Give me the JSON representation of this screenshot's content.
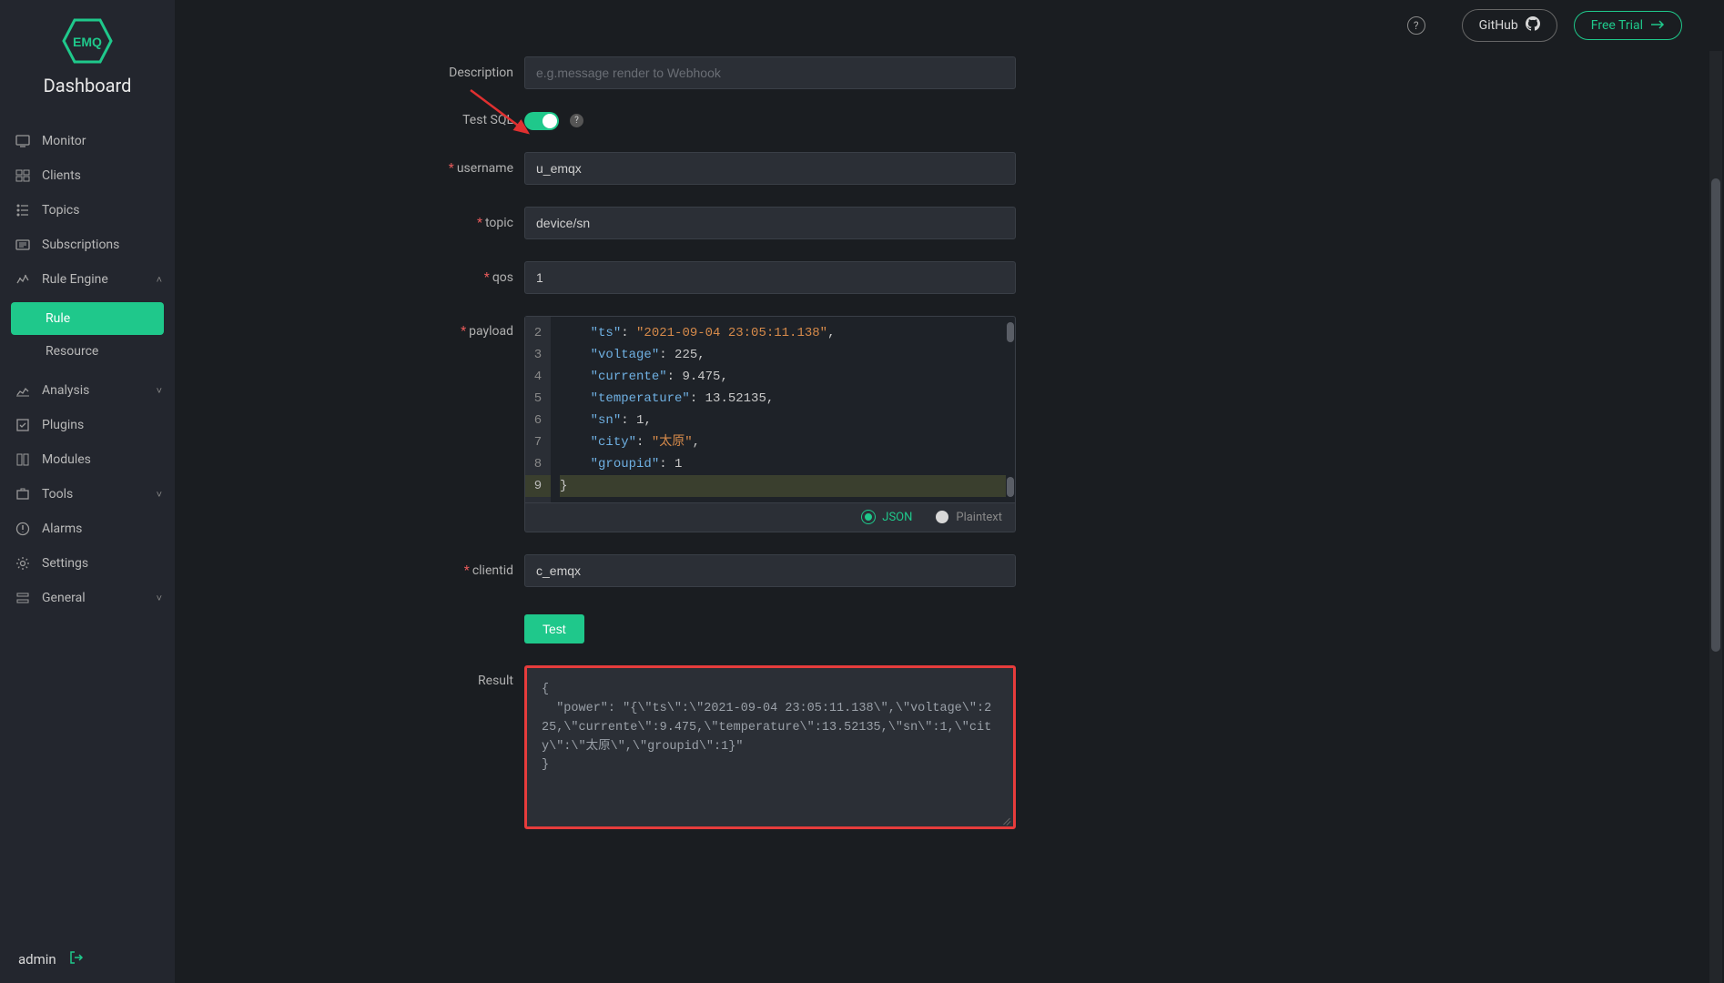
{
  "brand": {
    "logo_text": "EMQ",
    "title": "Dashboard"
  },
  "topbar": {
    "github_label": "GitHub",
    "trial_label": "Free Trial"
  },
  "sidebar": {
    "items": [
      {
        "label": "Monitor"
      },
      {
        "label": "Clients"
      },
      {
        "label": "Topics"
      },
      {
        "label": "Subscriptions"
      },
      {
        "label": "Rule Engine",
        "expanded": true,
        "children": [
          {
            "label": "Rule",
            "active": true
          },
          {
            "label": "Resource"
          }
        ]
      },
      {
        "label": "Analysis",
        "chev": "down"
      },
      {
        "label": "Plugins"
      },
      {
        "label": "Modules"
      },
      {
        "label": "Tools",
        "chev": "down"
      },
      {
        "label": "Alarms"
      },
      {
        "label": "Settings"
      },
      {
        "label": "General",
        "chev": "down"
      }
    ],
    "footer_user": "admin"
  },
  "form": {
    "description": {
      "label": "Description",
      "placeholder": "e.g.message render to Webhook",
      "value": ""
    },
    "test_sql": {
      "label": "Test SQL",
      "on": true
    },
    "username": {
      "label": "username",
      "value": "u_emqx"
    },
    "topic": {
      "label": "topic",
      "value": "device/sn"
    },
    "qos": {
      "label": "qos",
      "value": "1"
    },
    "payload": {
      "label": "payload",
      "lines": [
        {
          "n": 2,
          "indent": "    ",
          "key": "ts",
          "sep": ": ",
          "val_str": "2021-09-04 23:05:11.138",
          "trail": ","
        },
        {
          "n": 3,
          "indent": "    ",
          "key": "voltage",
          "sep": ": ",
          "val_num": "225",
          "trail": ","
        },
        {
          "n": 4,
          "indent": "    ",
          "key": "currente",
          "sep": ": ",
          "val_num": "9.475",
          "trail": ","
        },
        {
          "n": 5,
          "indent": "    ",
          "key": "temperature",
          "sep": ": ",
          "val_num": "13.52135",
          "trail": ","
        },
        {
          "n": 6,
          "indent": "    ",
          "key": "sn",
          "sep": ": ",
          "val_num": "1",
          "trail": ","
        },
        {
          "n": 7,
          "indent": "    ",
          "key": "city",
          "sep": ": ",
          "val_str": "太原",
          "trail": ","
        },
        {
          "n": 8,
          "indent": "    ",
          "key": "groupid",
          "sep": ": ",
          "val_num": "1",
          "trail": ""
        },
        {
          "n": 9,
          "raw": "}"
        }
      ],
      "format_json": "JSON",
      "format_plain": "Plaintext"
    },
    "clientid": {
      "label": "clientid",
      "value": "c_emqx"
    },
    "test_btn": "Test",
    "result": {
      "label": "Result",
      "text": "{\n  \"power\": \"{\\\"ts\\\":\\\"2021-09-04 23:05:11.138\\\",\\\"voltage\\\":225,\\\"currente\\\":9.475,\\\"temperature\\\":13.52135,\\\"sn\\\":1,\\\"city\\\":\\\"太原\\\",\\\"groupid\\\":1}\"\n}"
    }
  }
}
